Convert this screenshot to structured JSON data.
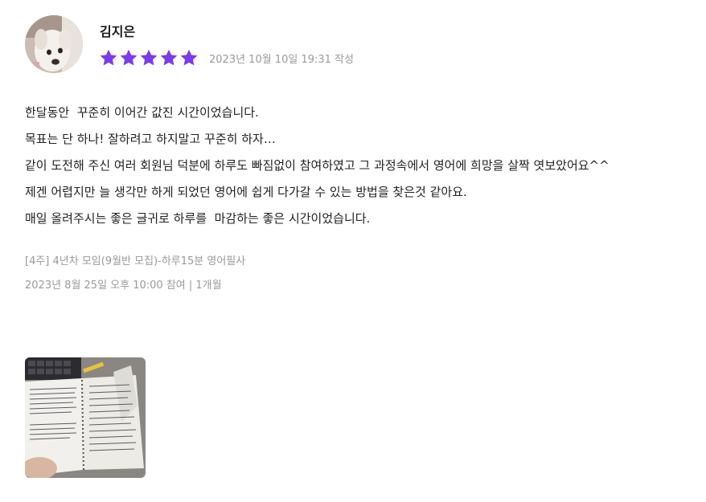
{
  "review": {
    "author": "김지은",
    "rating": 5,
    "rating_max": 5,
    "star_color": "#7c3aed",
    "date": "2023년 10월 10일 19:31 작성",
    "body_lines": [
      "한달동안  꾸준히 이어간 값진 시간이었습니다.",
      "목표는 단 하나! 잘하려고 하지말고 꾸준히 하자…",
      "같이 도전해 주신 여러 회원님 덕분에 하루도 빠짐없이 참여하였고 그 과정속에서 영어에 희망을 살짝 엿보았어요^^",
      "제겐 어렵지만 늘 생각만 하게 되었던 영어에 쉽게 다가갈 수 있는 방법을 찾은것 같아요.",
      "매일 올려주시는 좋은 글귀로 하루를  마감하는 좋은 시간이었습니다."
    ],
    "program_title": "[4주] 4년차 모임(9월반 모집)-하루15분 영어필사",
    "participation": "2023년 8월 25일 오후 10:00 참여 | 1개월"
  }
}
